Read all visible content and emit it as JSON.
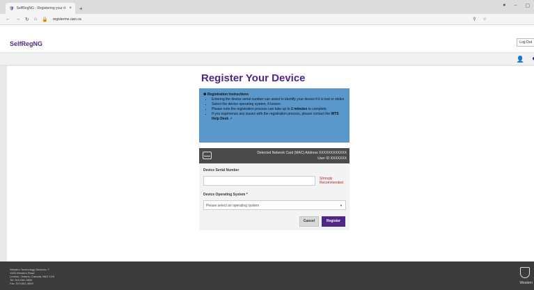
{
  "browser": {
    "tab_title": "SelfRegNG - Registering your d",
    "tab_close": "×",
    "new_tab": "+",
    "url": "registerme.uwo.ca",
    "window_controls": [
      "●",
      "–",
      "▢"
    ]
  },
  "header": {
    "brand": "SelfRegNG",
    "logout_label": "Log Out"
  },
  "page": {
    "title": "Register Your Device"
  },
  "instructions": {
    "title": "Registration Instructions",
    "items": [
      "Entering the device serial number can assist to identify your device if it is lost or stolen",
      "Select the device operating system, if known.",
      "Please note the registration process can take up to",
      "If you experience any issues with the registration process, please contact the"
    ],
    "emphasis_time": "2 minutes",
    "after_time": "to complete.",
    "helpdesk_link": "WTS Help Desk"
  },
  "device_info": {
    "mac_label": "Detected Network Card (MAC) Address",
    "mac_value": "XXXXXXXXXXXX",
    "user_label": "User ID",
    "user_value": "XXXXXXX"
  },
  "form": {
    "serial_label": "Device Serial Number",
    "serial_value": "",
    "serial_hint": "Strongly Recommended",
    "os_label": "Device Operating System *",
    "os_selected": "Please select an operating system",
    "cancel_label": "Cancel",
    "register_label": "Register"
  },
  "footer": {
    "lines": [
      "Western Technology Services",
      "1393 Western Road",
      "London, Ontario, Canada, N6G 1G9",
      "Tel: 519-661-3800",
      "Fax: 519-661-3600"
    ],
    "logo_text": "Western"
  },
  "colors": {
    "accent": "#4f2683",
    "info_bg": "#5a97cb",
    "device_bar": "#4a4a4a",
    "footer_bg": "#3b3b3b",
    "warning": "#b22222"
  }
}
